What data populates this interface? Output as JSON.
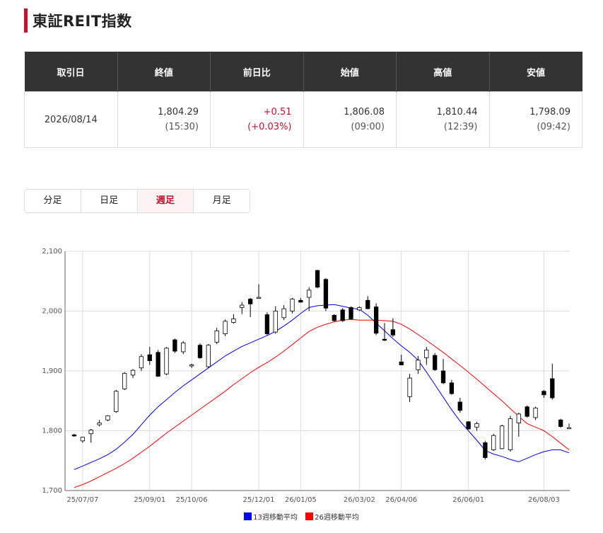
{
  "page": {
    "title": "東証REIT指数"
  },
  "quote": {
    "headers": [
      "取引日",
      "終値",
      "前日比",
      "始値",
      "高値",
      "安値"
    ],
    "date": "2026/08/14",
    "close": "1,804.29",
    "close_time": "(15:30)",
    "change": "+0.51",
    "change_pct": "(+0.03%)",
    "open": "1,806.08",
    "open_time": "(09:00)",
    "high": "1,810.44",
    "high_time": "(12:39)",
    "low": "1,798.09",
    "low_time": "(09:42)"
  },
  "tabs": [
    {
      "label": "分足",
      "active": false
    },
    {
      "label": "日足",
      "active": false
    },
    {
      "label": "週足",
      "active": true
    },
    {
      "label": "月足",
      "active": false
    }
  ],
  "colors": {
    "accent": "#c8102e",
    "ma13": "#0000ff",
    "ma26": "#ff0000",
    "up": "#ffffff",
    "down": "#000000"
  },
  "chart_data": {
    "type": "candlestick",
    "y_ticks": [
      "1,700",
      "1,800",
      "1,900",
      "2,000",
      "2,100"
    ],
    "ylim": [
      1700,
      2100
    ],
    "x_ticks": [
      "25/07/07",
      "25/09/01",
      "25/10/06",
      "25/12/01",
      "26/01/05",
      "26/03/02",
      "26/04/06",
      "26/06/01",
      "26/08/03"
    ],
    "x_tick_index": [
      1,
      9,
      14,
      22,
      27,
      34,
      39,
      47,
      56
    ],
    "grid": true,
    "candles": [
      [
        1793,
        1795,
        1790,
        1792
      ],
      [
        1783,
        1790,
        1780,
        1789
      ],
      [
        1795,
        1803,
        1780,
        1801
      ],
      [
        1810,
        1818,
        1807,
        1813
      ],
      [
        1818,
        1826,
        1816,
        1825
      ],
      [
        1832,
        1868,
        1830,
        1866
      ],
      [
        1870,
        1898,
        1868,
        1896
      ],
      [
        1893,
        1903,
        1888,
        1901
      ],
      [
        1905,
        1928,
        1900,
        1924
      ],
      [
        1927,
        1940,
        1910,
        1917
      ],
      [
        1931,
        1935,
        1890,
        1891
      ],
      [
        1895,
        1940,
        1893,
        1938
      ],
      [
        1952,
        1954,
        1930,
        1933
      ],
      [
        1932,
        1950,
        1928,
        1947
      ],
      [
        1910,
        1912,
        1905,
        1910
      ],
      [
        1943,
        1946,
        1920,
        1922
      ],
      [
        1907,
        1945,
        1905,
        1943
      ],
      [
        1948,
        1972,
        1945,
        1967
      ],
      [
        1962,
        1986,
        1958,
        1983
      ],
      [
        1981,
        1995,
        1979,
        1987
      ],
      [
        2006,
        2015,
        1995,
        2010
      ],
      [
        2020,
        2022,
        1990,
        2012
      ],
      [
        2022,
        2045,
        2021,
        2023
      ],
      [
        1994,
        1998,
        1960,
        1962
      ],
      [
        1965,
        2008,
        1962,
        2000
      ],
      [
        1989,
        2010,
        1985,
        2004
      ],
      [
        2000,
        2022,
        1996,
        2020
      ],
      [
        2018,
        2022,
        2014,
        2015
      ],
      [
        2023,
        2040,
        2000,
        2035
      ],
      [
        2068,
        2069,
        2038,
        2040
      ],
      [
        2053,
        2055,
        2000,
        2005
      ],
      [
        1993,
        1995,
        1982,
        1984
      ],
      [
        2002,
        2005,
        1982,
        1984
      ],
      [
        2006,
        2008,
        1985,
        1987
      ],
      [
        2002,
        2008,
        2000,
        2006
      ],
      [
        2018,
        2025,
        2003,
        2004
      ],
      [
        2007,
        2013,
        1960,
        1963
      ],
      [
        1953,
        1980,
        1950,
        1952
      ],
      [
        1969,
        1988,
        1957,
        1960
      ],
      [
        1915,
        1927,
        1910,
        1910
      ],
      [
        1857,
        1895,
        1848,
        1888
      ],
      [
        1902,
        1925,
        1895,
        1918
      ],
      [
        1922,
        1940,
        1910,
        1935
      ],
      [
        1926,
        1930,
        1900,
        1902
      ],
      [
        1900,
        1920,
        1878,
        1880
      ],
      [
        1880,
        1885,
        1860,
        1862
      ],
      [
        1848,
        1855,
        1830,
        1834
      ],
      [
        1815,
        1816,
        1802,
        1803
      ],
      [
        1806,
        1815,
        1800,
        1812
      ],
      [
        1780,
        1783,
        1752,
        1755
      ],
      [
        1768,
        1795,
        1766,
        1792
      ],
      [
        1770,
        1810,
        1769,
        1808
      ],
      [
        1768,
        1825,
        1765,
        1820
      ],
      [
        1813,
        1830,
        1790,
        1828
      ],
      [
        1840,
        1842,
        1822,
        1824
      ],
      [
        1822,
        1840,
        1818,
        1838
      ],
      [
        1866,
        1868,
        1855,
        1860
      ],
      [
        1887,
        1912,
        1852,
        1855
      ],
      [
        1818,
        1820,
        1805,
        1807
      ],
      [
        1805,
        1812,
        1803,
        1805
      ]
    ],
    "series": [
      {
        "name": "13週移動平均",
        "values": [
          1735,
          1741,
          1747,
          1753,
          1760,
          1769,
          1781,
          1794,
          1810,
          1826,
          1840,
          1852,
          1864,
          1875,
          1885,
          1895,
          1905,
          1915,
          1925,
          1933,
          1941,
          1947,
          1953,
          1959,
          1966,
          1975,
          1985,
          1996,
          2006,
          2009,
          2010,
          2011,
          2008,
          2005,
          2003,
          1993,
          1980,
          1967,
          1954,
          1942,
          1931,
          1918,
          1898,
          1877,
          1856,
          1835,
          1816,
          1800,
          1784,
          1767,
          1761,
          1757,
          1752,
          1748,
          1754,
          1760,
          1765,
          1768,
          1768,
          1763
        ]
      },
      {
        "name": "26週移動平均",
        "values": [
          1705,
          1710,
          1716,
          1723,
          1730,
          1737,
          1745,
          1754,
          1764,
          1774,
          1785,
          1796,
          1806,
          1816,
          1826,
          1836,
          1846,
          1856,
          1866,
          1877,
          1887,
          1897,
          1906,
          1914,
          1923,
          1933,
          1944,
          1955,
          1966,
          1973,
          1978,
          1982,
          1985,
          1986,
          1985,
          1985,
          1985,
          1984,
          1983,
          1978,
          1970,
          1961,
          1951,
          1941,
          1931,
          1920,
          1909,
          1898,
          1886,
          1874,
          1862,
          1850,
          1837,
          1824,
          1812,
          1806,
          1800,
          1790,
          1779,
          1768
        ]
      }
    ]
  }
}
